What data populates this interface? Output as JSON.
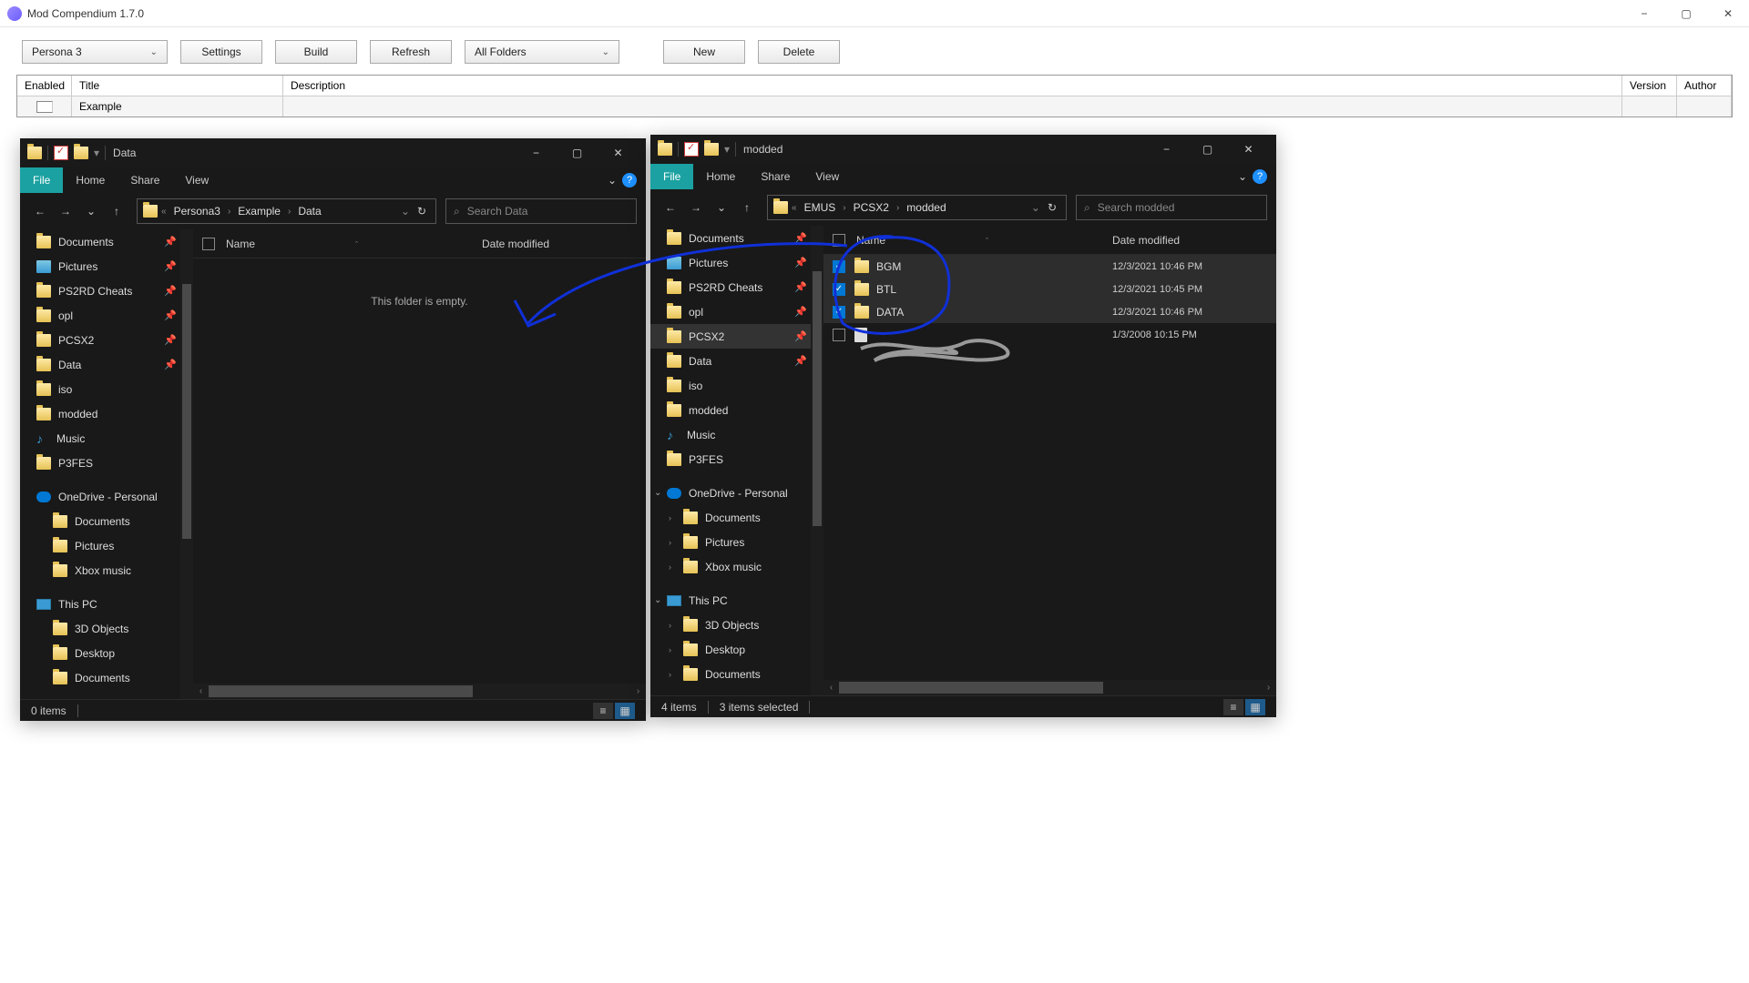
{
  "app": {
    "title": "Mod Compendium 1.7.0"
  },
  "toolbar": {
    "game": "Persona 3",
    "settings": "Settings",
    "build": "Build",
    "refresh": "Refresh",
    "folders": "All Folders",
    "new": "New",
    "delete": "Delete"
  },
  "grid": {
    "headers": {
      "enabled": "Enabled",
      "title": "Title",
      "description": "Description",
      "version": "Version",
      "author": "Author"
    },
    "rows": [
      {
        "enabled": false,
        "title": "Example",
        "description": "",
        "version": "",
        "author": ""
      }
    ]
  },
  "explorer1": {
    "title": "Data",
    "tabs": {
      "file": "File",
      "home": "Home",
      "share": "Share",
      "view": "View"
    },
    "crumbs": [
      "Persona3",
      "Example",
      "Data"
    ],
    "search_ph": "Search Data",
    "cols": {
      "name": "Name",
      "date": "Date modified"
    },
    "empty": "This folder is empty.",
    "nav": [
      {
        "icon": "folder",
        "label": "Documents",
        "pin": true
      },
      {
        "icon": "pic",
        "label": "Pictures",
        "pin": true
      },
      {
        "icon": "folder",
        "label": "PS2RD Cheats",
        "pin": true
      },
      {
        "icon": "folder",
        "label": "opl",
        "pin": true
      },
      {
        "icon": "folder",
        "label": "PCSX2",
        "pin": true
      },
      {
        "icon": "folder",
        "label": "Data",
        "pin": true
      },
      {
        "icon": "folder",
        "label": "iso"
      },
      {
        "icon": "folder",
        "label": "modded"
      },
      {
        "icon": "music",
        "label": "Music"
      },
      {
        "icon": "folder",
        "label": "P3FES"
      },
      {
        "spacer": true
      },
      {
        "icon": "cloud",
        "label": "OneDrive - Personal"
      },
      {
        "icon": "folder",
        "label": "Documents",
        "indent": true
      },
      {
        "icon": "folder",
        "label": "Pictures",
        "indent": true
      },
      {
        "icon": "folder",
        "label": "Xbox music",
        "indent": true
      },
      {
        "spacer": true
      },
      {
        "icon": "pc",
        "label": "This PC"
      },
      {
        "icon": "folder",
        "label": "3D Objects",
        "indent": true
      },
      {
        "icon": "folder",
        "label": "Desktop",
        "indent": true
      },
      {
        "icon": "folder",
        "label": "Documents",
        "indent": true
      }
    ],
    "status": "0 items"
  },
  "explorer2": {
    "title": "modded",
    "tabs": {
      "file": "File",
      "home": "Home",
      "share": "Share",
      "view": "View"
    },
    "crumbs": [
      "EMUS",
      "PCSX2",
      "modded"
    ],
    "search_ph": "Search modded",
    "cols": {
      "name": "Name",
      "date": "Date modified"
    },
    "files": [
      {
        "checked": true,
        "icon": "folder",
        "name": "BGM",
        "date": "12/3/2021 10:46 PM",
        "sel": true
      },
      {
        "checked": true,
        "icon": "folder",
        "name": "BTL",
        "date": "12/3/2021 10:45 PM",
        "sel": true
      },
      {
        "checked": true,
        "icon": "folder",
        "name": "DATA",
        "date": "12/3/2021 10:46 PM",
        "sel": true
      },
      {
        "checked": false,
        "icon": "file",
        "name": "",
        "date": "1/3/2008 10:15 PM",
        "scribble": true
      }
    ],
    "nav": [
      {
        "icon": "folder",
        "label": "Documents",
        "pin": true
      },
      {
        "icon": "pic",
        "label": "Pictures",
        "pin": true
      },
      {
        "icon": "folder",
        "label": "PS2RD Cheats",
        "pin": true
      },
      {
        "icon": "folder",
        "label": "opl",
        "pin": true
      },
      {
        "icon": "folder",
        "label": "PCSX2",
        "pin": true,
        "sel": true
      },
      {
        "icon": "folder",
        "label": "Data",
        "pin": true
      },
      {
        "icon": "folder",
        "label": "iso"
      },
      {
        "icon": "folder",
        "label": "modded"
      },
      {
        "icon": "music",
        "label": "Music"
      },
      {
        "icon": "folder",
        "label": "P3FES"
      },
      {
        "spacer": true
      },
      {
        "icon": "cloud",
        "label": "OneDrive - Personal",
        "exp": "v"
      },
      {
        "icon": "folder",
        "label": "Documents",
        "indent": true,
        "chev": true
      },
      {
        "icon": "folder",
        "label": "Pictures",
        "indent": true,
        "chev": true
      },
      {
        "icon": "folder",
        "label": "Xbox music",
        "indent": true,
        "chev": true
      },
      {
        "spacer": true
      },
      {
        "icon": "pc",
        "label": "This PC",
        "exp": "v"
      },
      {
        "icon": "folder",
        "label": "3D Objects",
        "indent": true,
        "chev": true
      },
      {
        "icon": "folder",
        "label": "Desktop",
        "indent": true,
        "chev": true
      },
      {
        "icon": "folder",
        "label": "Documents",
        "indent": true,
        "chev": true
      }
    ],
    "status1": "4 items",
    "status2": "3 items selected"
  }
}
